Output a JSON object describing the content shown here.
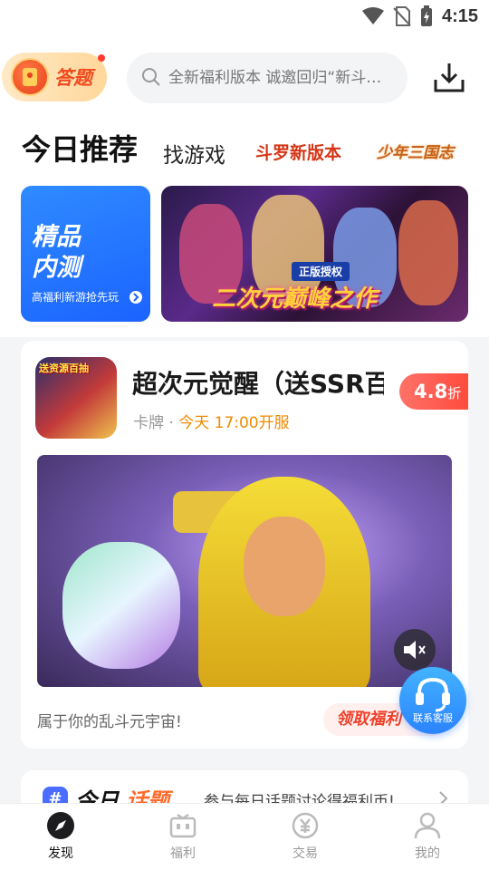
{
  "status_bar": {
    "time": "4:15"
  },
  "header": {
    "quiz_label": "答题",
    "search_placeholder": "全新福利版本 诚邀回归“新斗…"
  },
  "tabs": [
    {
      "label": "今日推荐",
      "active": true
    },
    {
      "label": "找游戏",
      "active": false
    },
    {
      "label": "斗罗新版本",
      "active": false
    },
    {
      "label": "少年三国志",
      "active": false
    }
  ],
  "banners": {
    "left": {
      "title_line1": "精品",
      "title_line2": "内测",
      "subtitle": "高福利新游抢先玩"
    },
    "right": {
      "tag": "正版授权",
      "slogan": "二次元巅峰之作"
    }
  },
  "game_card": {
    "icon_badge": "送资源百抽",
    "title": "超次元觉醒（送SSR百抽）",
    "category": "卡牌",
    "separator": "·",
    "open_time": "今天 17:00开服",
    "discount_value": "4.8",
    "discount_unit": "折",
    "slogan": "属于你的乱斗元宇宙!",
    "claim_label": "领取福利"
  },
  "customer_service": {
    "label": "联系客服"
  },
  "topic": {
    "hash": "#",
    "title_part1": "今日",
    "title_part2": "话题",
    "description": "参与每日话题讨论得福利币!"
  },
  "bottom_nav": [
    {
      "label": "发现",
      "active": true
    },
    {
      "label": "福利",
      "active": false
    },
    {
      "label": "交易",
      "active": false
    },
    {
      "label": "我的",
      "active": false
    }
  ]
}
